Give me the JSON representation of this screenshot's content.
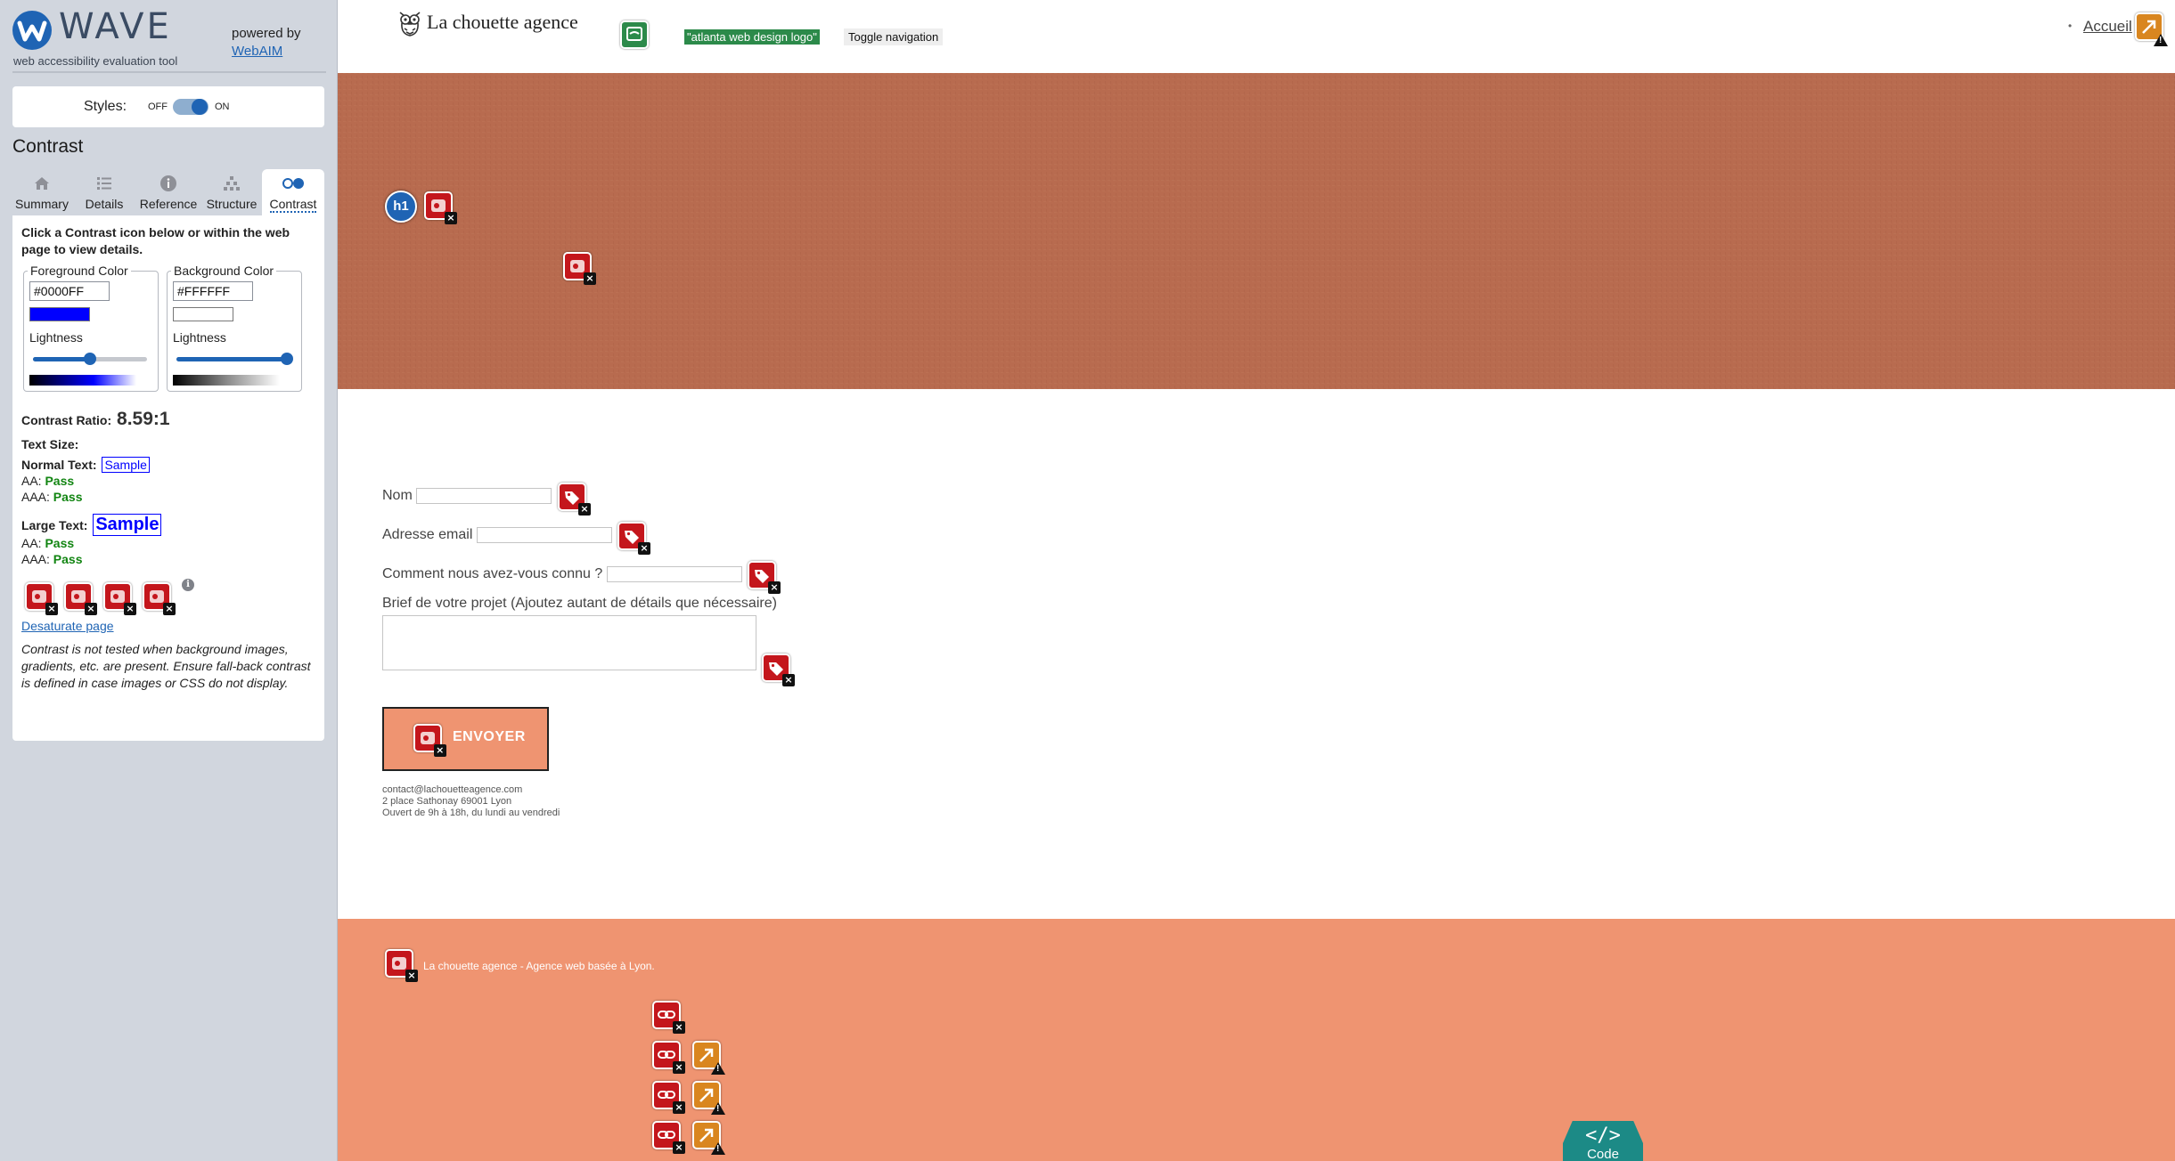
{
  "wave": {
    "brand": "WAVE",
    "tagline": "web accessibility evaluation tool",
    "powered_by": "powered by",
    "webaim_link": "WebAIM",
    "styles": {
      "label": "Styles:",
      "off": "OFF",
      "on": "ON",
      "state": "on"
    },
    "panel_title": "Contrast",
    "tabs": [
      {
        "label": "Summary",
        "icon": "home-icon"
      },
      {
        "label": "Details",
        "icon": "list-icon"
      },
      {
        "label": "Reference",
        "icon": "info-icon"
      },
      {
        "label": "Structure",
        "icon": "structure-icon"
      },
      {
        "label": "Contrast",
        "icon": "contrast-icon",
        "active": true
      }
    ],
    "contrast": {
      "instructions": "Click a Contrast icon below or within the web page to view details.",
      "foreground": {
        "legend": "Foreground Color",
        "hex": "#0000FF",
        "swatch": "#0000FF",
        "lightness_label": "Lightness",
        "lightness": 0.5
      },
      "background": {
        "legend": "Background Color",
        "hex": "#FFFFFF",
        "swatch": "#FFFFFF",
        "lightness_label": "Lightness",
        "lightness": 0.97
      },
      "ratio_label": "Contrast Ratio:",
      "ratio": "8.59:1",
      "text_size_label": "Text Size:",
      "normal_text_label": "Normal Text:",
      "large_text_label": "Large Text:",
      "sample": "Sample",
      "aa_label": "AA:",
      "aaa_label": "AAA:",
      "normal_aa": "Pass",
      "normal_aaa": "Pass",
      "large_aa": "Pass",
      "large_aaa": "Pass",
      "error_icon_count": 4,
      "desaturate_link": "Desaturate page",
      "note": "Contrast is not tested when background images, gradients, etc. are present. Ensure fall-back contrast is defined in case images or CSS do not display."
    }
  },
  "site": {
    "brand_name": "La chouette agence",
    "logo_alt_text": "\"atlanta web design logo\"",
    "toggle_nav": "Toggle navigation",
    "nav": [
      {
        "label": "Accueil"
      }
    ],
    "heading_badge": "h1",
    "hero_color": "#b86b4f",
    "footer_color": "#ef9471",
    "form": {
      "nom_label": "Nom",
      "email_label": "Adresse email",
      "source_label": "Comment nous avez-vous connu ?",
      "brief_label": "Brief de votre projet (Ajoutez autant de détails que nécessaire)",
      "submit": "ENVOYER"
    },
    "contact": {
      "email": "contact@lachouetteagence.com",
      "address": "2 place Sathonay 69001 Lyon",
      "hours": "Ouvert de 9h à 18h, du lundi au vendredi"
    },
    "footer_text": "La chouette agence - Agence web basée à Lyon.",
    "code_tab": {
      "glyph": "</>",
      "label": "Code"
    }
  },
  "colors": {
    "wave_blue": "#1f64b4",
    "error_red": "#c4161c",
    "alert_orange": "#d9861f",
    "pass_green": "#128512"
  }
}
